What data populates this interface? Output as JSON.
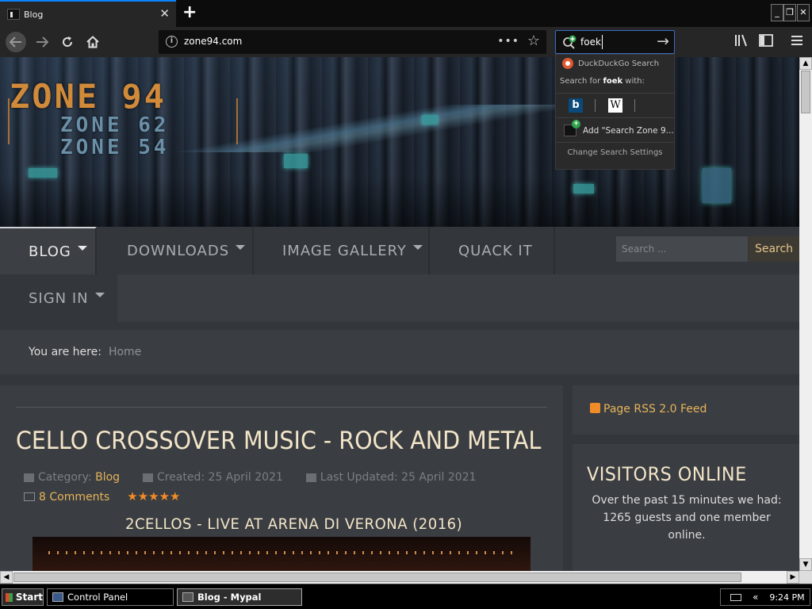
{
  "browser": {
    "tab_title": "Blog",
    "tab_close": "✕",
    "new_tab": "+",
    "url": "zone94.com",
    "page_actions": "•••",
    "search_query": "foek",
    "window_buttons": [
      "_",
      "❐",
      "✕"
    ]
  },
  "search_dropdown": {
    "header": "DuckDuckGo Search",
    "search_for_prefix": "Search for ",
    "search_for_term": "foek",
    "search_for_suffix": " with:",
    "engines": [
      "bing-icon",
      "wikipedia-icon"
    ],
    "add_engine": "Add \"Search Zone 9...",
    "settings": "Change Search Settings"
  },
  "site": {
    "logo_main": "ZONE 94",
    "logo_sub1": "ZONE 62",
    "logo_sub2": "ZONE 54",
    "menu": [
      {
        "label": "BLOG",
        "has_caret": true,
        "active": true
      },
      {
        "label": "DOWNLOADS",
        "has_caret": true,
        "active": false
      },
      {
        "label": "IMAGE GALLERY",
        "has_caret": true,
        "active": false
      },
      {
        "label": "QUACK IT",
        "has_caret": false,
        "active": false
      },
      {
        "label": "SIGN IN",
        "has_caret": true,
        "active": false
      }
    ],
    "search_placeholder": "Search ...",
    "search_button": "Search",
    "breadcrumb_label": "You are here:",
    "breadcrumb_home": "Home"
  },
  "article": {
    "title": "CELLO CROSSOVER MUSIC - ROCK AND METAL",
    "category_label": "Category: ",
    "category": "Blog",
    "created": "Created: 25 April 2021",
    "updated": "Last Updated: 25 April 2021",
    "comments": "8 Comments",
    "rating": "★★★★★",
    "subtitle": "2CELLOS - LIVE AT ARENA DI VERONA (2016)"
  },
  "sidebar": {
    "rss": "Page RSS 2.0 Feed",
    "visitors_title": "VISITORS ONLINE",
    "visitors_text": "Over the past 15 minutes we had: 1265 guests and one member online."
  },
  "taskbar": {
    "start": "Start",
    "tasks": [
      "Control Panel",
      "Blog - Mypal"
    ],
    "tray_chevron": "«",
    "clock": "9:24 PM"
  },
  "colors": {
    "accent_gold": "#e6b45a",
    "title_cream": "#f3e5c8",
    "star_orange": "#f08c28",
    "focus_blue": "#3a6cc8"
  }
}
